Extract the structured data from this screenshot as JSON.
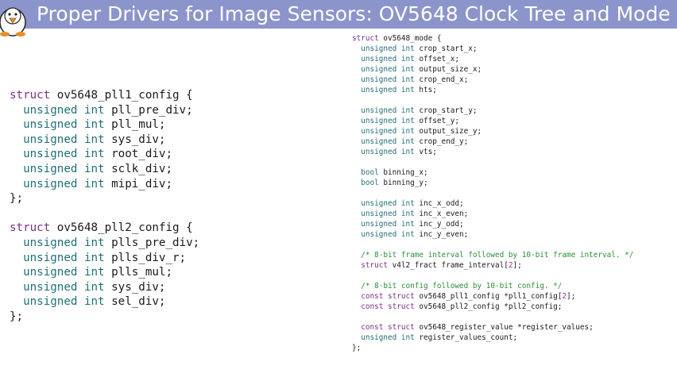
{
  "header": {
    "title": "Proper Drivers for Image Sensors: OV5648 Clock Tree and Mode",
    "colors": {
      "bar": "#8c94cc",
      "title_text": "#ffffff"
    },
    "logo_icon": "penguin-icon"
  },
  "syntax_colors": {
    "keyword": "#7a2f8a",
    "type": "#1f6f78",
    "comment": "#2a8f3a",
    "number": "#9a2f9a"
  },
  "left_code": [
    [
      [
        "kw",
        "struct "
      ],
      [
        "nm",
        "ov5648_pll1_config {"
      ]
    ],
    [
      [
        "ty",
        "  unsigned int "
      ],
      [
        "nm",
        "pll_pre_div;"
      ]
    ],
    [
      [
        "ty",
        "  unsigned int "
      ],
      [
        "nm",
        "pll_mul;"
      ]
    ],
    [
      [
        "ty",
        "  unsigned int "
      ],
      [
        "nm",
        "sys_div;"
      ]
    ],
    [
      [
        "ty",
        "  unsigned int "
      ],
      [
        "nm",
        "root_div;"
      ]
    ],
    [
      [
        "ty",
        "  unsigned int "
      ],
      [
        "nm",
        "sclk_div;"
      ]
    ],
    [
      [
        "ty",
        "  unsigned int "
      ],
      [
        "nm",
        "mipi_div;"
      ]
    ],
    [
      [
        "nm",
        "};"
      ]
    ],
    [
      [
        "nm",
        " "
      ]
    ],
    [
      [
        "kw",
        "struct "
      ],
      [
        "nm",
        "ov5648_pll2_config {"
      ]
    ],
    [
      [
        "ty",
        "  unsigned int "
      ],
      [
        "nm",
        "plls_pre_div;"
      ]
    ],
    [
      [
        "ty",
        "  unsigned int "
      ],
      [
        "nm",
        "plls_div_r;"
      ]
    ],
    [
      [
        "ty",
        "  unsigned int "
      ],
      [
        "nm",
        "plls_mul;"
      ]
    ],
    [
      [
        "ty",
        "  unsigned int "
      ],
      [
        "nm",
        "sys_div;"
      ]
    ],
    [
      [
        "ty",
        "  unsigned int "
      ],
      [
        "nm",
        "sel_div;"
      ]
    ],
    [
      [
        "nm",
        "};"
      ]
    ]
  ],
  "right_code": [
    [
      [
        "kw",
        "struct "
      ],
      [
        "nm",
        "ov5648_mode {"
      ]
    ],
    [
      [
        "ty",
        "  unsigned int "
      ],
      [
        "nm",
        "crop_start_x;"
      ]
    ],
    [
      [
        "ty",
        "  unsigned int "
      ],
      [
        "nm",
        "offset_x;"
      ]
    ],
    [
      [
        "ty",
        "  unsigned int "
      ],
      [
        "nm",
        "output_size_x;"
      ]
    ],
    [
      [
        "ty",
        "  unsigned int "
      ],
      [
        "nm",
        "crop_end_x;"
      ]
    ],
    [
      [
        "ty",
        "  unsigned int "
      ],
      [
        "nm",
        "hts;"
      ]
    ],
    [
      [
        "nm",
        " "
      ]
    ],
    [
      [
        "ty",
        "  unsigned int "
      ],
      [
        "nm",
        "crop_start_y;"
      ]
    ],
    [
      [
        "ty",
        "  unsigned int "
      ],
      [
        "nm",
        "offset_y;"
      ]
    ],
    [
      [
        "ty",
        "  unsigned int "
      ],
      [
        "nm",
        "output_size_y;"
      ]
    ],
    [
      [
        "ty",
        "  unsigned int "
      ],
      [
        "nm",
        "crop_end_y;"
      ]
    ],
    [
      [
        "ty",
        "  unsigned int "
      ],
      [
        "nm",
        "vts;"
      ]
    ],
    [
      [
        "nm",
        " "
      ]
    ],
    [
      [
        "ty",
        "  bool "
      ],
      [
        "nm",
        "binning_x;"
      ]
    ],
    [
      [
        "ty",
        "  bool "
      ],
      [
        "nm",
        "binning_y;"
      ]
    ],
    [
      [
        "nm",
        " "
      ]
    ],
    [
      [
        "ty",
        "  unsigned int "
      ],
      [
        "nm",
        "inc_x_odd;"
      ]
    ],
    [
      [
        "ty",
        "  unsigned int "
      ],
      [
        "nm",
        "inc_x_even;"
      ]
    ],
    [
      [
        "ty",
        "  unsigned int "
      ],
      [
        "nm",
        "inc_y_odd;"
      ]
    ],
    [
      [
        "ty",
        "  unsigned int "
      ],
      [
        "nm",
        "inc_y_even;"
      ]
    ],
    [
      [
        "nm",
        " "
      ]
    ],
    [
      [
        "cm",
        "  /* 8-bit frame interval followed by 10-bit frame interval. */"
      ]
    ],
    [
      [
        "kw",
        "  struct "
      ],
      [
        "nm",
        "v4l2_fract frame_interval["
      ],
      [
        "num",
        "2"
      ],
      [
        "nm",
        "];"
      ]
    ],
    [
      [
        "nm",
        " "
      ]
    ],
    [
      [
        "cm",
        "  /* 8-bit config followed by 10-bit config. */"
      ]
    ],
    [
      [
        "kw",
        "  const struct "
      ],
      [
        "nm",
        "ov5648_pll1_config *pll1_config["
      ],
      [
        "num",
        "2"
      ],
      [
        "nm",
        "];"
      ]
    ],
    [
      [
        "kw",
        "  const struct "
      ],
      [
        "nm",
        "ov5648_pll2_config *pll2_config;"
      ]
    ],
    [
      [
        "nm",
        " "
      ]
    ],
    [
      [
        "kw",
        "  const struct "
      ],
      [
        "nm",
        "ov5648_register_value *register_values;"
      ]
    ],
    [
      [
        "ty",
        "  unsigned int "
      ],
      [
        "nm",
        "register_values_count;"
      ]
    ],
    [
      [
        "nm",
        "};"
      ]
    ]
  ]
}
